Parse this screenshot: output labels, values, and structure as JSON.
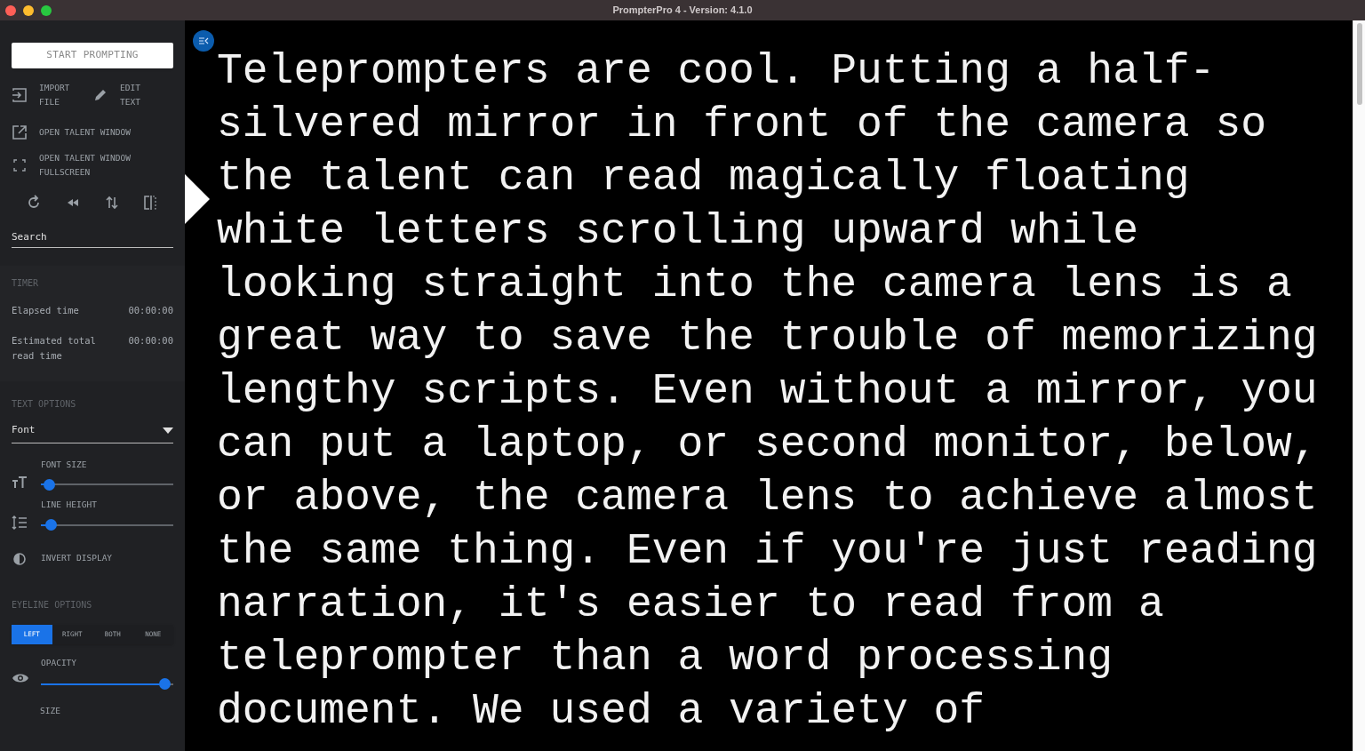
{
  "window": {
    "title": "PrompterPro 4 - Version: 4.1.0"
  },
  "sidebar": {
    "start_button": "START PROMPTING",
    "actions": [
      {
        "kind": "import",
        "label": "IMPORT\nFILE"
      },
      {
        "kind": "edit",
        "label": "EDIT\nTEXT"
      }
    ],
    "window_actions": [
      {
        "kind": "open",
        "label": "OPEN TALENT WINDOW"
      },
      {
        "kind": "fullscreen",
        "label": "OPEN TALENT WINDOW\nFULLSCREEN"
      }
    ],
    "search": {
      "placeholder": "Search"
    },
    "timer": {
      "heading": "TIMER",
      "rows": [
        {
          "label": "Elapsed time",
          "value": "00:00:00"
        },
        {
          "label": "Estimated total\nread time",
          "value": "00:00:00"
        }
      ]
    },
    "text_options": {
      "heading": "TEXT OPTIONS",
      "font": {
        "placeholder": "Font"
      },
      "sliders": [
        {
          "kind": "font-size",
          "label": "FONT SIZE",
          "level": 0.05
        },
        {
          "kind": "line-height",
          "label": "LINE HEIGHT",
          "level": 0.06
        }
      ],
      "invert": "INVERT DISPLAY"
    },
    "eyeline_options": {
      "heading": "EYELINE OPTIONS",
      "choices": [
        {
          "label": "LEFT",
          "selected": true
        },
        {
          "label": "RIGHT",
          "selected": false
        },
        {
          "label": "BOTH",
          "selected": false
        },
        {
          "label": "NONE",
          "selected": false
        }
      ],
      "opacity": {
        "label": "OPACITY",
        "level": 0.92
      },
      "size": {
        "label": "SIZE"
      }
    }
  },
  "prompter": {
    "text": "Teleprompters are cool. Putting a half-silvered mirror in front of the camera so the talent can read magically floating white letters scrolling upward while looking straight into the camera lens is a great way to save the trouble of memorizing lengthy scripts. Even without a mirror, you can put a laptop, or second monitor, below, or above, the camera lens to achieve almost the same thing. Even if you're just reading narration, it's easier to read from a teleprompter than a word processing document. We used a variety of"
  }
}
